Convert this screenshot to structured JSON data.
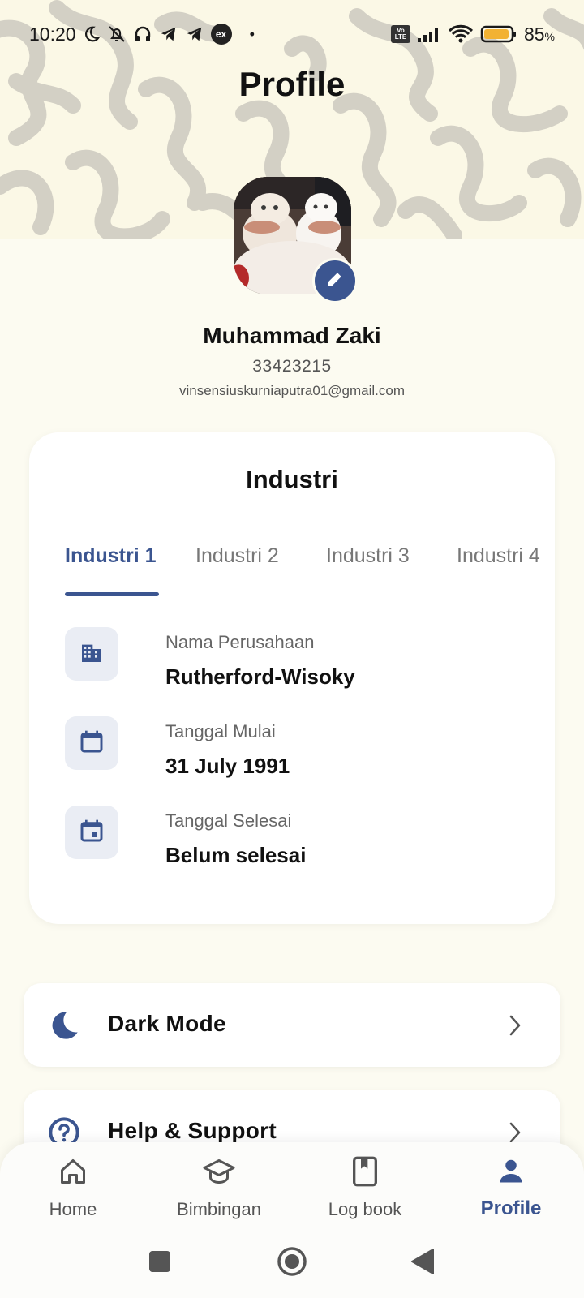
{
  "status_bar": {
    "time": "10:20",
    "battery_percent": "85",
    "battery_unit": "%",
    "volte_label": "Vo LTE",
    "ex_badge": "ex",
    "icons": [
      "moon-icon",
      "bell-off-icon",
      "headset-icon",
      "telegram-icon",
      "telegram-icon",
      "ex-icon",
      "volte-icon",
      "signal-icon",
      "wifi-icon",
      "battery-icon"
    ]
  },
  "header": {
    "title": "Profile"
  },
  "profile": {
    "name": "Muhammad Zaki",
    "id": "33423215",
    "email": "vinsensiuskurniaputra01@gmail.com"
  },
  "industri": {
    "title": "Industri",
    "tabs": [
      "Industri 1",
      "Industri 2",
      "Industri 3",
      "Industri 4"
    ],
    "active_tab": 0,
    "fields": [
      {
        "label": "Nama Perusahaan",
        "value": "Rutherford-Wisoky",
        "icon": "building-icon"
      },
      {
        "label": "Tanggal Mulai",
        "value": "31 July 1991",
        "icon": "calendar-icon"
      },
      {
        "label": "Tanggal Selesai",
        "value": "Belum selesai",
        "icon": "calendar-event-icon"
      }
    ]
  },
  "menu": [
    {
      "label": "Dark Mode",
      "icon": "moon-icon"
    },
    {
      "label": "Help & Support",
      "icon": "help-icon"
    }
  ],
  "bottom_nav": {
    "items": [
      {
        "label": "Home",
        "icon": "home-icon"
      },
      {
        "label": "Bimbingan",
        "icon": "graduation-cap-icon"
      },
      {
        "label": "Log book",
        "icon": "book-icon"
      },
      {
        "label": "Profile",
        "icon": "person-icon"
      }
    ],
    "active": 3
  },
  "colors": {
    "accent": "#3b5590",
    "background": "#fcfbf1",
    "card": "#ffffff",
    "icon_bg": "#eaedf4",
    "battery": "#f2b233"
  }
}
